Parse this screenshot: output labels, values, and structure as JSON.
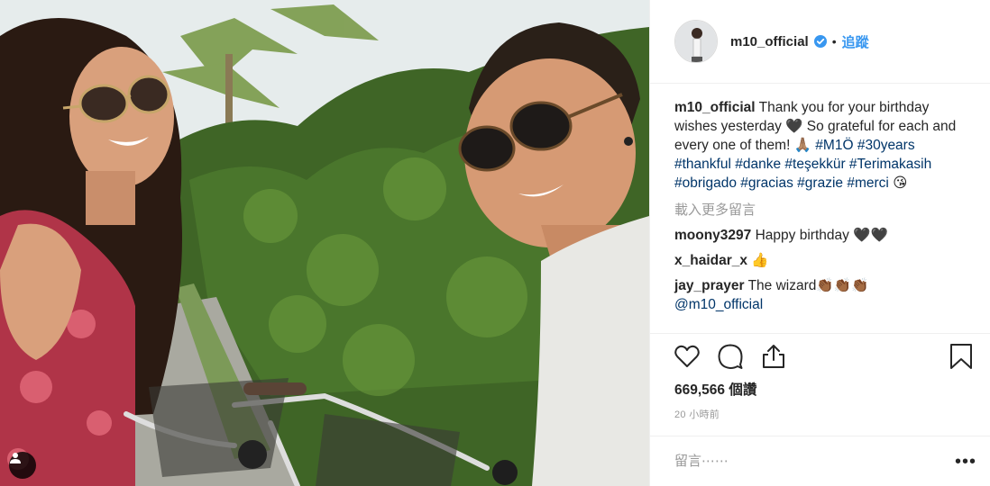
{
  "post": {
    "username": "m10_official",
    "verified": true,
    "separator": "•",
    "follow_label": "追蹤"
  },
  "caption": {
    "username": "m10_official",
    "text": " Thank you for your birthday wishes yesterday 🖤 So grateful for each and every one of them! 🙏🏽 ",
    "hashtags": [
      "#M1Ö",
      "#30years",
      "#thankful",
      "#danke",
      "#teşekkür",
      "#Terimakasih",
      "#obrigado",
      "#gracias",
      "#grazie",
      "#merci"
    ],
    "emoji_end": " 😘"
  },
  "load_more_label": "載入更多留言",
  "comments": [
    {
      "username": "moony3297",
      "text": " Happy birthday 🖤🖤"
    },
    {
      "username": "x_haidar_x",
      "text": " 👍"
    },
    {
      "username": "jay_prayer",
      "text": " The wizard👏🏾👏🏾👏🏾",
      "mention": "@m10_official"
    }
  ],
  "likes": "669,566 個讚",
  "time_ago": "20 小時前",
  "comment_input": {
    "placeholder": "留言⋯⋯",
    "value": ""
  },
  "more_options": "•••",
  "icons": [
    "heart-icon",
    "comment-icon",
    "share-icon",
    "bookmark-icon",
    "user-tag-icon",
    "verified-badge-icon"
  ],
  "colors": {
    "link": "#003569",
    "follow": "#3897f0",
    "verified": "#3897f0",
    "muted": "#999999"
  }
}
